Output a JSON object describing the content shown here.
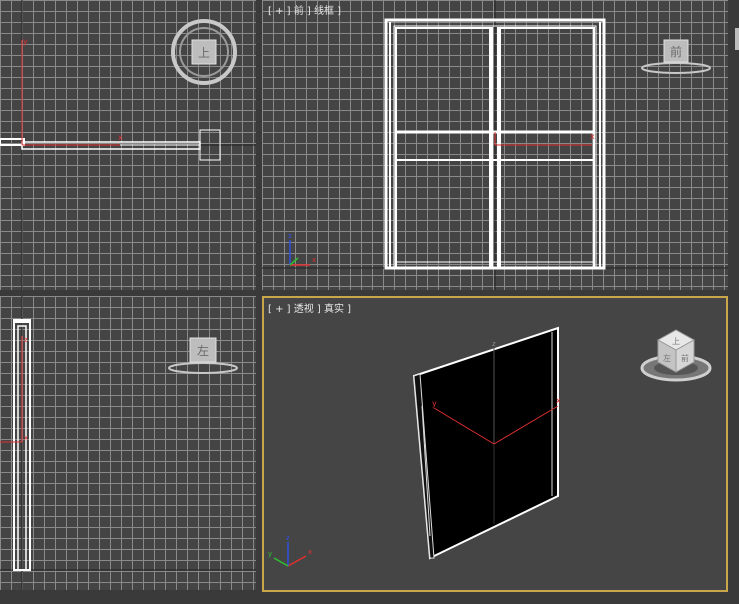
{
  "viewports": {
    "top": {
      "label": "",
      "navcube": "上"
    },
    "front": {
      "label": "[ + ] 前 ] 线框 ]",
      "navcube": "前"
    },
    "left": {
      "label": "",
      "navcube": "左"
    },
    "perspective": {
      "label": "[ + ] 透视 ] 真实 ]",
      "navcube_top": "上",
      "navcube_left": "左",
      "navcube_front": "前"
    }
  },
  "axes": {
    "x": "x",
    "y": "y",
    "z": "z"
  },
  "colors": {
    "grid": "#8a8a8a",
    "viewport_bg": "#444444",
    "active_border": "#c9a64a",
    "object_wire": "#ffffff",
    "gizmo_red": "#e03030",
    "gizmo_green": "#30c030",
    "gizmo_blue": "#3050e0"
  }
}
